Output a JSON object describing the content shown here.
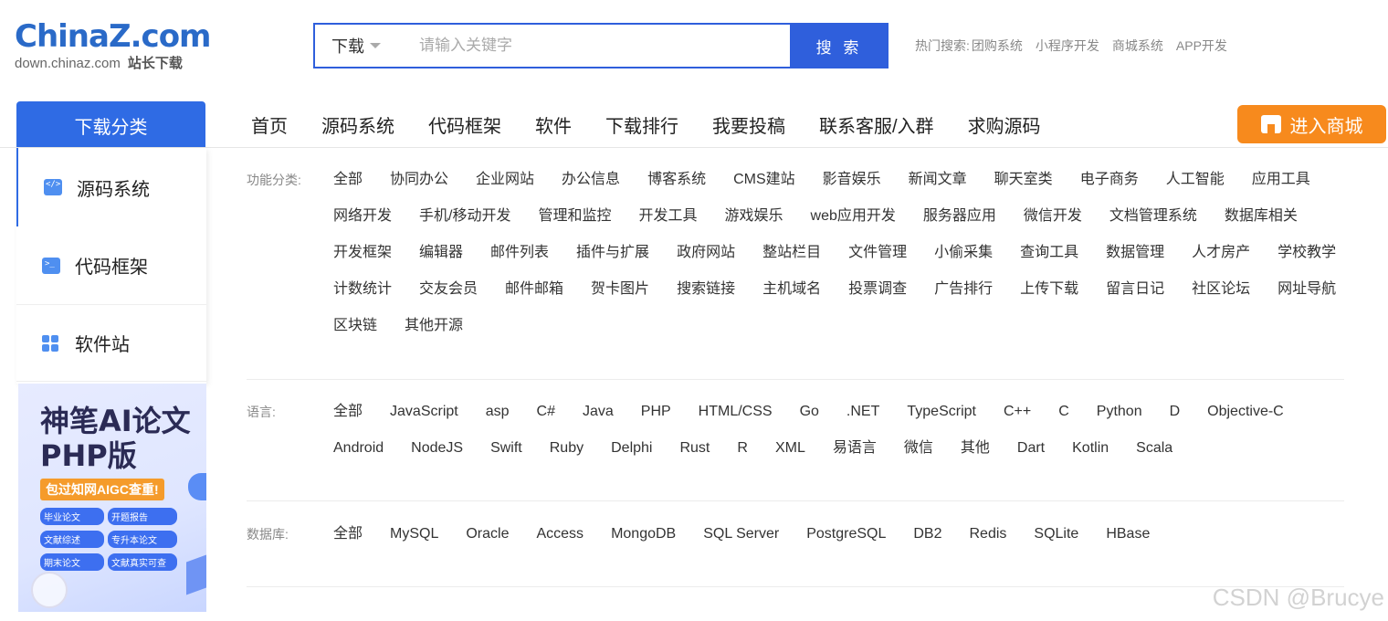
{
  "logo": {
    "brand_prefix": "China",
    "brand_suffix": "Z.com",
    "domain": "down.chinaz.com",
    "tagline": "站长下载"
  },
  "search": {
    "type_label": "下载",
    "placeholder": "请输入关键字",
    "button_label": "搜 索"
  },
  "hot": {
    "label": "热门搜索:",
    "items": [
      "团购系统",
      "小程序开发",
      "商城系统",
      "APP开发"
    ]
  },
  "nav": {
    "category_tab": "下载分类",
    "items": [
      "首页",
      "源码系统",
      "代码框架",
      "软件",
      "下载排行",
      "我要投稿",
      "联系客服/入群",
      "求购源码"
    ],
    "mall_button": "进入商城"
  },
  "side": {
    "items": [
      {
        "label": "源码系统",
        "icon": "code-icon"
      },
      {
        "label": "代码框架",
        "icon": "terminal-icon"
      },
      {
        "label": "软件站",
        "icon": "apps-grid-icon"
      }
    ]
  },
  "ad": {
    "title_line1": "神笔AI论文",
    "title_line2": "PHP版",
    "badge": "包过知网AIGC查重!",
    "tags": [
      "毕业论文",
      "开题报告",
      "文献综述",
      "专升本论文",
      "期末论文",
      "文献真实可查"
    ]
  },
  "filters": {
    "function": {
      "label": "功能分类:",
      "options": [
        "全部",
        "协同办公",
        "企业网站",
        "办公信息",
        "博客系统",
        "CMS建站",
        "影音娱乐",
        "新闻文章",
        "聊天室类",
        "电子商务",
        "人工智能",
        "应用工具",
        "网络开发",
        "手机/移动开发",
        "管理和监控",
        "开发工具",
        "游戏娱乐",
        "web应用开发",
        "服务器应用",
        "微信开发",
        "文档管理系统",
        "数据库相关",
        "开发框架",
        "编辑器",
        "邮件列表",
        "插件与扩展",
        "政府网站",
        "整站栏目",
        "文件管理",
        "小偷采集",
        "查询工具",
        "数据管理",
        "人才房产",
        "学校教学",
        "计数统计",
        "交友会员",
        "邮件邮箱",
        "贺卡图片",
        "搜索链接",
        "主机域名",
        "投票调查",
        "广告排行",
        "上传下载",
        "留言日记",
        "社区论坛",
        "网址导航",
        "区块链",
        "其他开源"
      ]
    },
    "language": {
      "label": "语言:",
      "options": [
        "全部",
        "JavaScript",
        "asp",
        "C#",
        "Java",
        "PHP",
        "HTML/CSS",
        "Go",
        ".NET",
        "TypeScript",
        "C++",
        "C",
        "Python",
        "D",
        "Objective-C",
        "Android",
        "NodeJS",
        "Swift",
        "Ruby",
        "Delphi",
        "Rust",
        "R",
        "XML",
        "易语言",
        "微信",
        "其他",
        "Dart",
        "Kotlin",
        "Scala"
      ]
    },
    "database": {
      "label": "数据库:",
      "options": [
        "全部",
        "MySQL",
        "Oracle",
        "Access",
        "MongoDB",
        "SQL Server",
        "PostgreSQL",
        "DB2",
        "Redis",
        "SQLite",
        "HBase"
      ]
    }
  },
  "watermark": "CSDN @Brucye",
  "colors": {
    "primary_blue": "#2f5fdc",
    "tab_blue": "#2f6be4",
    "mall_orange": "#f78a1d"
  }
}
